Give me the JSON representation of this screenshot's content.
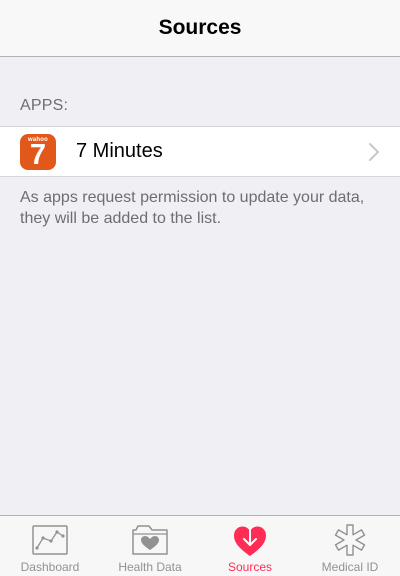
{
  "nav": {
    "title": "Sources"
  },
  "apps_section": {
    "header": "APPS:",
    "items": [
      {
        "name": "7 Minutes",
        "icon": {
          "brand": "wahoo",
          "number": "7",
          "color": "#e2571a"
        }
      }
    ],
    "footer": "As apps request permission to update your data, they will be added to the list."
  },
  "tab_bar": {
    "active_color": "#ff2d55",
    "inactive_color": "#929292",
    "tabs": [
      {
        "label": "Dashboard",
        "icon": "dashboard-chart-icon",
        "active": false
      },
      {
        "label": "Health Data",
        "icon": "health-data-folder-icon",
        "active": false
      },
      {
        "label": "Sources",
        "icon": "sources-heart-icon",
        "active": true
      },
      {
        "label": "Medical ID",
        "icon": "medical-id-asterisk-icon",
        "active": false
      }
    ]
  }
}
